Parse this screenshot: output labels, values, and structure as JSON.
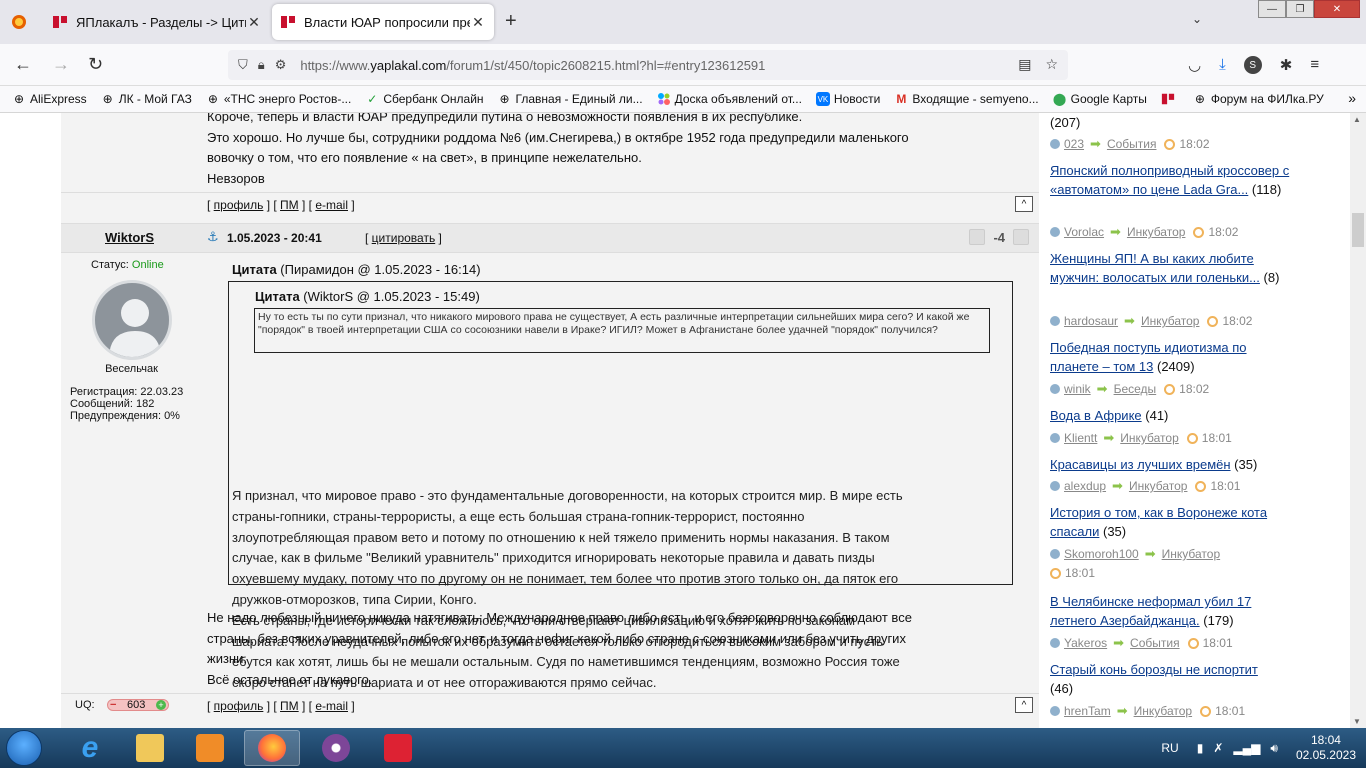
{
  "browser": {
    "tabs": [
      {
        "title": "ЯПлакалъ - Разделы -> Цитир",
        "active": false
      },
      {
        "title": "Власти ЮАР попросили прези",
        "active": true
      }
    ],
    "url_prefix": "https://www.",
    "url_domain": "yaplakal.com",
    "url_path": "/forum1/st/450/topic2608215.html?hl=#entry123612591",
    "profile_letter": "S",
    "bookmarks": [
      {
        "label": "AliExpress",
        "icon": "globe-icon"
      },
      {
        "label": "ЛК - Мой ГАЗ",
        "icon": "globe-icon"
      },
      {
        "label": "«ТНС энерго Ростов-...",
        "icon": "globe-icon"
      },
      {
        "label": "Сбербанк Онлайн",
        "icon": "sber-icon"
      },
      {
        "label": "Главная - Единый ли...",
        "icon": "globe-icon"
      },
      {
        "label": "Доска объявлений от...",
        "icon": "avito-icon"
      },
      {
        "label": "Новости",
        "icon": "vk-icon"
      },
      {
        "label": "Входящие - semyeno...",
        "icon": "gmail-icon"
      },
      {
        "label": "Google Карты",
        "icon": "maps-icon"
      },
      {
        "label": "",
        "icon": "yaplakal-icon"
      },
      {
        "label": "Форум на ФИЛка.РУ",
        "icon": "globe-icon"
      }
    ]
  },
  "prev_post": {
    "lines": [
      "Короче, теперь и власти ЮАР предупредили путина о невозможности появления в их республике.",
      "Это хорошо. Но лучше бы, сотрудники роддома №6 (им.Снегирева,) в октябре 1952 года предупредили маленького",
      "вовочку о том, что его появление « на свет», в принципе нежелательно.",
      "Невзоров"
    ]
  },
  "footer_links": {
    "profile": "профиль",
    "pm": "ПМ",
    "email": "e-mail",
    "up": "^"
  },
  "post": {
    "author": "WiktorS",
    "date": "1.05.2023 - 20:41",
    "quote_button": "цитировать",
    "rating": "-4",
    "status_label": "Статус:",
    "status_value": "Online",
    "rank": "Весельчак",
    "stats": [
      "Регистрация: 22.03.23",
      "Сообщений: 182",
      "Предупреждения: 0%"
    ],
    "uq_label": "UQ:",
    "uq_value": "603",
    "quote_outer_author": "Цитата",
    "quote_outer_meta": " (Пирамидон @ 1.05.2023 - 16:14)",
    "quote_inner_author": "Цитата",
    "quote_inner_meta": " (WiktorS @ 1.05.2023 - 15:49)",
    "quote_inner_text": "Ну то есть ты по сути признал, что никакого мирового права не существует, А есть различные интерпретации сильнейших мира сего? И какой же \"порядок\" в твоей интерпретации США со сосоюзники навели в Ираке? ИГИЛ? Может в Афганистане более удачней \"порядок\" получился?",
    "quote_outer_lines": [
      "Я признал, что мировое право - это фундаментальные договоренности, на которых строится мир. В мире есть",
      "страны-гопники, страны-террористы, а еще есть большая страна-гопник-террорист, постоянно",
      "злоупотребляющая правом вето и потому по отношению к ней тяжело применить нормы наказания. В таком",
      "случае, как в фильме \"Великий уравнитель\" приходится игнорировать некоторые правила и давать пизды",
      "охуевшему мудаку, потому что по другому он не понимает, тем более что против этого только он, да пяток его",
      "дружков-отморозков, типа Сирии, Конго.",
      "Есть страны, где исторически так сложилось, что они отвергают цивилизацию и хотят жить по законам",
      "шариата. После неудачных попыток их образумить остается только отгородиться высоким забором и пусть",
      "ебутся как хотят, лишь бы не мешали остальным. Судя по наметившимся тенденциям, возможно Россия тоже",
      "скоро станет на путь шариата и от нее отгораживаются прямо сейчас."
    ],
    "body_lines": [
      "Не надо любезный ничего никуда натягивать: Международное право либо есть, и его безоговорочно соблюдают все",
      "страны, без всяких уравнителей, либо его нет, и тогда нефиг какой либо стране с союзниками или без учить других",
      "жизни.",
      "Всё остальное от лукавого."
    ]
  },
  "sidebar": {
    "top_count": "(207)",
    "top_meta": {
      "user": "023",
      "section": "События",
      "time": "18:02"
    },
    "items": [
      {
        "title": "Японский полноприводный кроссовер с «автоматом» по цене Lada Gra...",
        "count": "(118)",
        "user": "Vorolac",
        "section": "Инкубатор",
        "time": "18:02"
      },
      {
        "title": "Женщины ЯП! А вы каких любите мужчин: волосатых или голеньки...",
        "count": "(8)",
        "user": "hardosaur",
        "section": "Инкубатор",
        "time": "18:02"
      },
      {
        "title": "Победная поступь идиотизма по планете – том 13",
        "count": "(2409)",
        "user": "winik",
        "section": "Беседы",
        "time": "18:02"
      },
      {
        "title": "Вода в Африке",
        "count": "(41)",
        "user": "Klientt",
        "section": "Инкубатор",
        "time": "18:01"
      },
      {
        "title": "Красавицы из лучших времён",
        "count": "(35)",
        "user": "alexdup",
        "section": "Инкубатор",
        "time": "18:01"
      },
      {
        "title": "История о том, как в Воронеже кота спасали",
        "count": "(35)",
        "user": "Skomoroh100",
        "section": "Инкубатор",
        "time": "18:01"
      },
      {
        "title": "В Челябинске неформал убил 17 летнего Азербайджанца.",
        "count": "(179)",
        "user": "Yakeros",
        "section": "События",
        "time": "18:01"
      },
      {
        "title": "Старый конь борозды не испортит",
        "count": "(46)",
        "user": "hrenTam",
        "section": "Инкубатор",
        "time": "18:01"
      }
    ]
  },
  "taskbar": {
    "lang": "RU",
    "time": "18:04",
    "date": "02.05.2023"
  }
}
